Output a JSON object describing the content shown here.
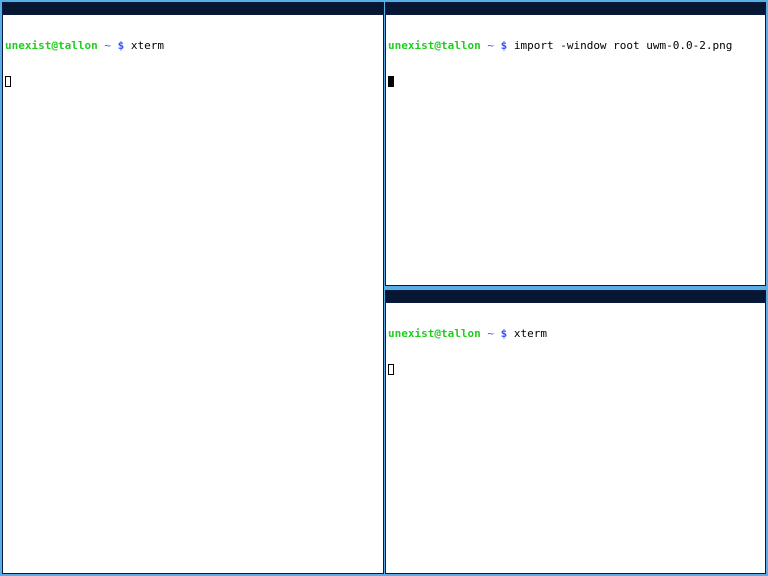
{
  "colors": {
    "desktop_bg": "#5aaee8",
    "titlebar": "#071633",
    "user_host": "#22cc22",
    "prompt_symbols": "#3355ff"
  },
  "windows": [
    {
      "id": "left",
      "prompt": {
        "user_host": "unexist@tallon",
        "dir": "~",
        "symbol": "$"
      },
      "command": "xterm",
      "cursor": "hollow"
    },
    {
      "id": "top-right",
      "prompt": {
        "user_host": "unexist@tallon",
        "dir": "~",
        "symbol": "$"
      },
      "command": "import -window root uwm-0.0-2.png",
      "cursor": "solid"
    },
    {
      "id": "bottom-right",
      "prompt": {
        "user_host": "unexist@tallon",
        "dir": "~",
        "symbol": "$"
      },
      "command": "xterm",
      "cursor": "hollow"
    }
  ]
}
